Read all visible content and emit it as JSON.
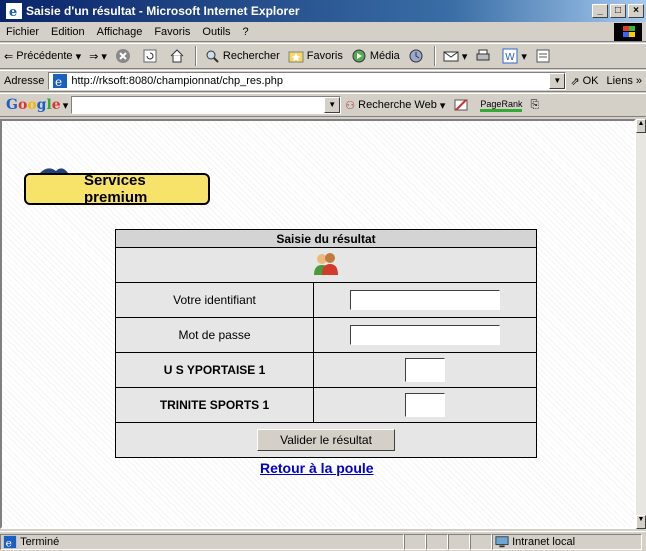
{
  "window": {
    "title": "Saisie d'un résultat - Microsoft Internet Explorer",
    "min": "_",
    "max": "□",
    "close": "×"
  },
  "menu": [
    "Fichier",
    "Edition",
    "Affichage",
    "Favoris",
    "Outils",
    "?"
  ],
  "toolbar": {
    "back": "Précédente",
    "search": "Rechercher",
    "favorites": "Favoris",
    "media": "Média"
  },
  "address": {
    "label": "Adresse",
    "url": "http://rksoft:8080/championnat/chp_res.php",
    "go": "OK",
    "links": "Liens »"
  },
  "google": {
    "logo": "Google",
    "search_web": "Recherche Web",
    "pagerank": "PageRank"
  },
  "logo": {
    "text": "Services premium"
  },
  "form": {
    "title": "Saisie du résultat",
    "fields": [
      {
        "label": "Votre identifiant",
        "value": ""
      },
      {
        "label": "Mot de passe",
        "value": ""
      }
    ],
    "teams": [
      {
        "name": "U S YPORTAISE 1",
        "score": ""
      },
      {
        "name": "TRINITE SPORTS 1",
        "score": ""
      }
    ],
    "submit": "Valider le résultat"
  },
  "link_back": "Retour à la poule",
  "status": {
    "text": "Terminé",
    "zone": "Intranet local"
  }
}
